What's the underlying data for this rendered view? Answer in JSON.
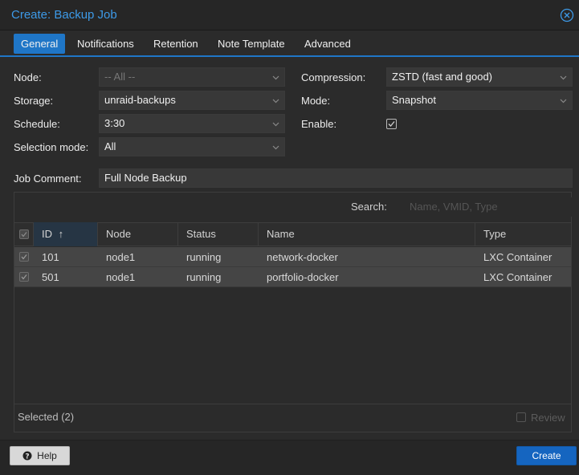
{
  "dialog": {
    "title": "Create: Backup Job"
  },
  "tabs": [
    "General",
    "Notifications",
    "Retention",
    "Note Template",
    "Advanced"
  ],
  "form": {
    "node_label": "Node:",
    "node_value": "-- All --",
    "storage_label": "Storage:",
    "storage_value": "unraid-backups",
    "schedule_label": "Schedule:",
    "schedule_value": "3:30",
    "selection_mode_label": "Selection mode:",
    "selection_mode_value": "All",
    "compression_label": "Compression:",
    "compression_value": "ZSTD (fast and good)",
    "mode_label": "Mode:",
    "mode_value": "Snapshot",
    "enable_label": "Enable:",
    "enable_checked": true,
    "job_comment_label": "Job Comment:",
    "job_comment_value": "Full Node Backup"
  },
  "grid": {
    "search_label": "Search:",
    "search_placeholder": "Name, VMID, Type",
    "columns": [
      "ID",
      "Node",
      "Status",
      "Name",
      "Type"
    ],
    "sort_indicator": "↑",
    "rows": [
      {
        "id": "101",
        "node": "node1",
        "status": "running",
        "name": "network-docker",
        "type": "LXC Container"
      },
      {
        "id": "501",
        "node": "node1",
        "status": "running",
        "name": "portfolio-docker",
        "type": "LXC Container"
      }
    ],
    "selected_text": "Selected (2)",
    "review_label": "Review"
  },
  "buttons": {
    "help": "Help",
    "create": "Create"
  },
  "colors": {
    "accent": "#1f76c7",
    "title": "#3d9ae8"
  }
}
